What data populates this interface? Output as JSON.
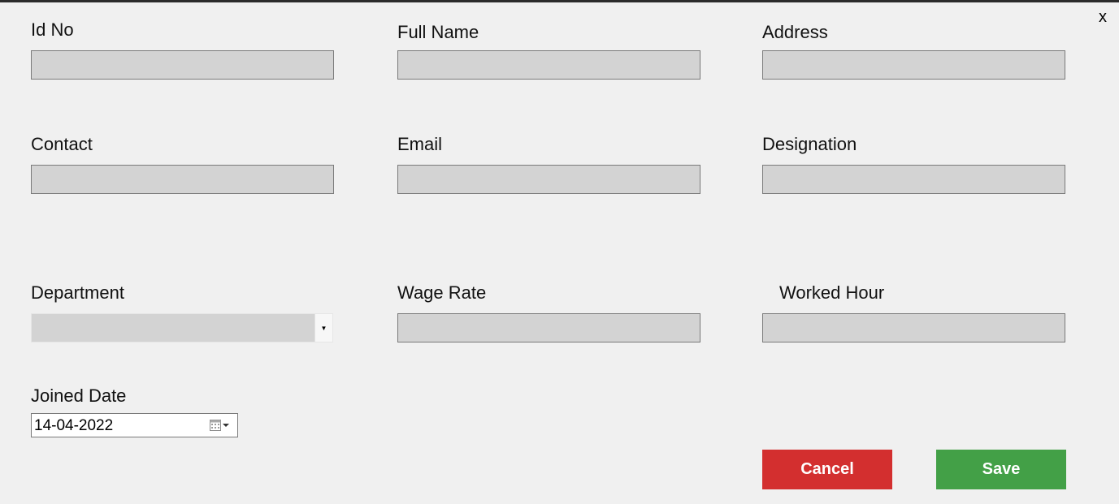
{
  "window": {
    "close_label": "x"
  },
  "fields": {
    "id_no": {
      "label": "Id No",
      "value": ""
    },
    "full_name": {
      "label": "Full Name",
      "value": ""
    },
    "address": {
      "label": "Address",
      "value": ""
    },
    "contact": {
      "label": "Contact",
      "value": ""
    },
    "email": {
      "label": "Email",
      "value": ""
    },
    "designation": {
      "label": "Designation",
      "value": ""
    },
    "department": {
      "label": "Department",
      "selected": ""
    },
    "wage_rate": {
      "label": "Wage Rate",
      "value": ""
    },
    "worked_hour": {
      "label": "Worked Hour",
      "value": ""
    },
    "joined_date": {
      "label": "Joined Date",
      "value": "14-04-2022"
    }
  },
  "actions": {
    "cancel_label": "Cancel",
    "save_label": "Save"
  },
  "colors": {
    "cancel": "#d32f2f",
    "save": "#43a047",
    "input_bg": "#d3d3d3",
    "background": "#f0f0f0"
  },
  "icons": {
    "close": "close-icon",
    "dropdown": "chevron-down-icon",
    "calendar": "calendar-icon"
  }
}
